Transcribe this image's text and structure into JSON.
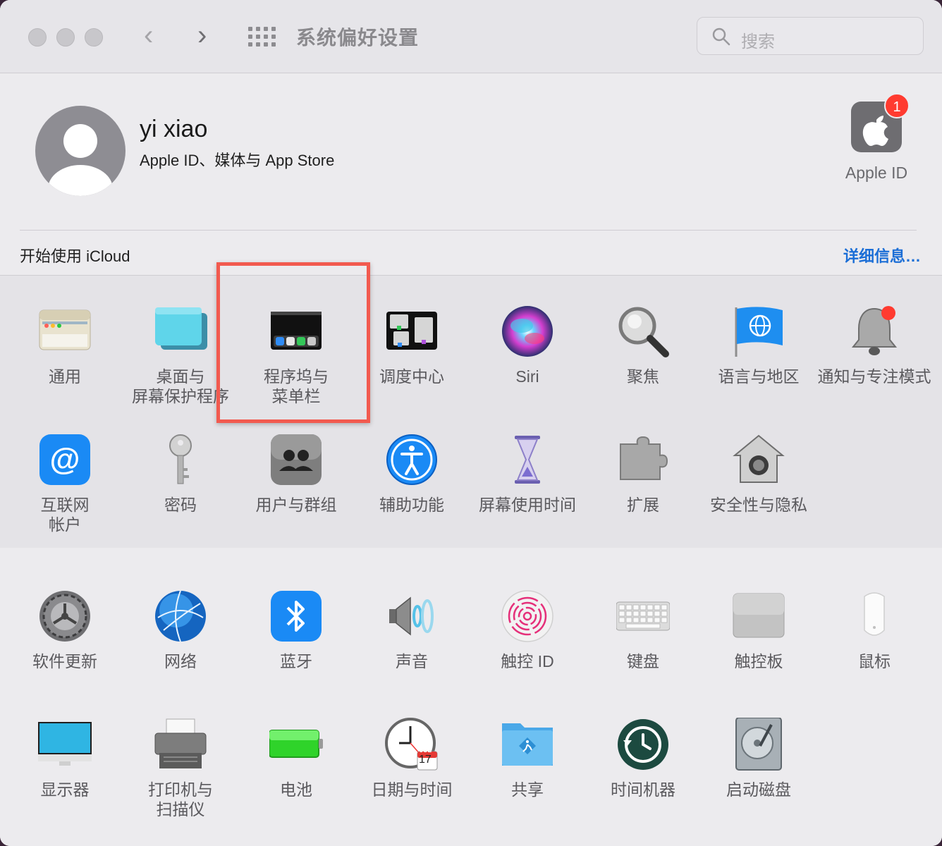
{
  "window": {
    "title": "系统偏好设置",
    "search_placeholder": "搜索"
  },
  "account": {
    "name": "yi xiao",
    "subtitle": "Apple ID、媒体与 App Store",
    "apple_id_label": "Apple ID",
    "badge_count": "1",
    "icloud_prompt": "开始使用 iCloud",
    "details_link": "详细信息…"
  },
  "panes_row1": [
    {
      "label": "通用",
      "icon": "general-icon"
    },
    {
      "label": "桌面与\n屏幕保护程序",
      "icon": "desktop-icon"
    },
    {
      "label": "程序坞与\n菜单栏",
      "icon": "dock-icon"
    },
    {
      "label": "调度中心",
      "icon": "mission-control-icon"
    },
    {
      "label": "Siri",
      "icon": "siri-icon"
    },
    {
      "label": "聚焦",
      "icon": "spotlight-icon"
    },
    {
      "label": "语言与地区",
      "icon": "language-icon"
    },
    {
      "label": "通知与专注模式",
      "icon": "notifications-icon"
    }
  ],
  "panes_row2": [
    {
      "label": "互联网\n帐户",
      "icon": "internet-accounts-icon"
    },
    {
      "label": "密码",
      "icon": "passwords-icon"
    },
    {
      "label": "用户与群组",
      "icon": "users-icon"
    },
    {
      "label": "辅助功能",
      "icon": "accessibility-icon"
    },
    {
      "label": "屏幕使用时间",
      "icon": "screen-time-icon"
    },
    {
      "label": "扩展",
      "icon": "extensions-icon"
    },
    {
      "label": "安全性与隐私",
      "icon": "security-icon"
    }
  ],
  "panes_row3": [
    {
      "label": "软件更新",
      "icon": "software-update-icon"
    },
    {
      "label": "网络",
      "icon": "network-icon"
    },
    {
      "label": "蓝牙",
      "icon": "bluetooth-icon"
    },
    {
      "label": "声音",
      "icon": "sound-icon"
    },
    {
      "label": "触控 ID",
      "icon": "touch-id-icon"
    },
    {
      "label": "键盘",
      "icon": "keyboard-icon"
    },
    {
      "label": "触控板",
      "icon": "trackpad-icon"
    },
    {
      "label": "鼠标",
      "icon": "mouse-icon"
    }
  ],
  "panes_row4": [
    {
      "label": "显示器",
      "icon": "displays-icon"
    },
    {
      "label": "打印机与\n扫描仪",
      "icon": "printers-icon"
    },
    {
      "label": "电池",
      "icon": "battery-icon"
    },
    {
      "label": "日期与时间",
      "icon": "date-time-icon"
    },
    {
      "label": "共享",
      "icon": "sharing-icon"
    },
    {
      "label": "时间机器",
      "icon": "time-machine-icon"
    },
    {
      "label": "启动磁盘",
      "icon": "startup-disk-icon"
    }
  ],
  "date_icon": {
    "month": "JUL",
    "day": "17"
  },
  "highlighted_pane": "程序坞与\n菜单栏"
}
